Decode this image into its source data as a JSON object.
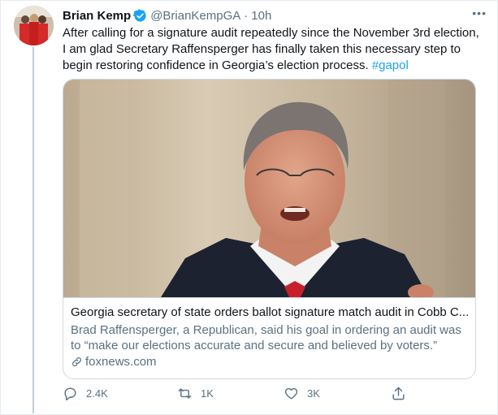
{
  "tweet": {
    "author_name": "Brian Kemp",
    "handle": "@BrianKempGA",
    "separator": "·",
    "time": "10h",
    "text_main": "After calling for a signature audit repeatedly since the November 3rd election, I am glad Secretary Raffensperger has finally taken this necessary step to begin restoring confidence in Georgia’s election process. ",
    "hashtag": "#gapol",
    "more_label": "•••"
  },
  "card": {
    "title": "Georgia secretary of state orders ballot signature match audit in Cobb C...",
    "description": "Brad Raffensperger, a Republican, said his goal in ordering an audit was to “make our elections accurate and secure and believed by voters.”",
    "domain": "foxnews.com"
  },
  "actions": {
    "reply_count": "2.4K",
    "retweet_count": "1K",
    "like_count": "3K"
  },
  "colors": {
    "accent": "#1da1f2",
    "secondary_text": "#5b7083",
    "border": "#cfd9de"
  },
  "icons": [
    "verified-badge-icon",
    "more-icon",
    "link-icon",
    "reply-icon",
    "retweet-icon",
    "like-icon",
    "share-icon"
  ]
}
